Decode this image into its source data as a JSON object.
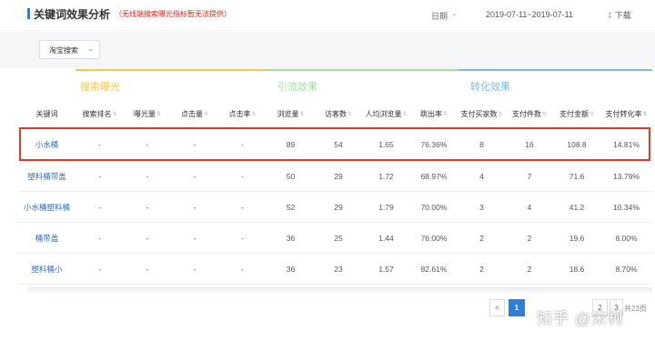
{
  "header": {
    "title": "关键词效果分析",
    "note": "（无线端搜索曝光指标暂无法提供）",
    "date_label": "日期",
    "date_range": "2019-07-11~2019-07-11",
    "download_label": "下载"
  },
  "source_select": {
    "value": "淘宝搜索"
  },
  "groups": [
    {
      "label": "搜索曝光",
      "color": "#f5c54a"
    },
    {
      "label": "引流效果",
      "color": "#9fe09b"
    },
    {
      "label": "转化效果",
      "color": "#7fb6e8"
    }
  ],
  "columns": [
    "关键词",
    "搜索排名",
    "曝光量",
    "点击量",
    "点击率",
    "浏览量",
    "访客数",
    "人均浏览量",
    "跳出率",
    "支付买家数",
    "支付件数",
    "支付金额",
    "支付转化率"
  ],
  "rows": [
    [
      "小水桶",
      "-",
      "-",
      "-",
      "-",
      "89",
      "54",
      "1.65",
      "76.36%",
      "8",
      "16",
      "108.8",
      "14.81%"
    ],
    [
      "塑料桶带盖",
      "-",
      "-",
      "-",
      "-",
      "50",
      "29",
      "1.72",
      "68.97%",
      "4",
      "7",
      "71.6",
      "13.79%"
    ],
    [
      "小水桶塑料桶",
      "-",
      "-",
      "-",
      "-",
      "52",
      "29",
      "1.79",
      "70.00%",
      "3",
      "4",
      "41.2",
      "10.34%"
    ],
    [
      "桶带盖",
      "-",
      "-",
      "-",
      "-",
      "36",
      "25",
      "1.44",
      "76.00%",
      "2",
      "2",
      "19.6",
      "8.00%"
    ],
    [
      "塑料桶小",
      "-",
      "-",
      "-",
      "-",
      "36",
      "23",
      "1.57",
      "82.61%",
      "2",
      "2",
      "18.6",
      "8.70%"
    ]
  ],
  "pagination": {
    "prev": "<",
    "current": "1",
    "pages": [
      "2",
      "3"
    ],
    "total": "共23页"
  },
  "watermark": "知乎 @宋柯",
  "icons": {
    "sort": "sort-icon",
    "chevron": "chevron-down-icon",
    "download": "download-icon"
  },
  "accent_color": "#2f7ed8",
  "highlight_color": "#e0392b"
}
